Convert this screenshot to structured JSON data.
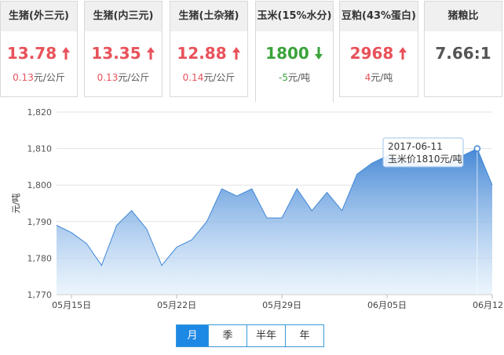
{
  "cards": [
    {
      "title": "生猪(外三元)",
      "value": "13.78",
      "change": "0.13",
      "unit": "元/公斤",
      "dir": "up"
    },
    {
      "title": "生猪(内三元)",
      "value": "13.35",
      "change": "0.13",
      "unit": "元/公斤",
      "dir": "up"
    },
    {
      "title": "生猪(土杂猪)",
      "value": "12.88",
      "change": "0.14",
      "unit": "元/公斤",
      "dir": "up"
    },
    {
      "title": "玉米(15%水分)",
      "value": "1800",
      "change": "-5",
      "unit": "元/吨",
      "dir": "down"
    },
    {
      "title": "豆粕(43%蛋白)",
      "value": "2968",
      "change": "4",
      "unit": "元/吨",
      "dir": "up"
    },
    {
      "title": "猪粮比",
      "value": "7.66:1",
      "change": "",
      "unit": "",
      "dir": "neutral"
    }
  ],
  "colors": {
    "up": "#e8525a",
    "down": "#3aa33a",
    "line": "#3f86d6",
    "accent": "#1e88e5"
  },
  "periods": [
    "月",
    "季",
    "半年",
    "年"
  ],
  "active_period": "月",
  "chart_data": {
    "type": "area",
    "ylabel": "元/吨",
    "ylim": [
      1770,
      1820
    ],
    "yticks": [
      "1,770",
      "1,780",
      "1,790",
      "1,800",
      "1,810",
      "1,820"
    ],
    "xtick_labels": [
      "05月15日",
      "05月22日",
      "05月29日",
      "06月05日",
      "06月12日"
    ],
    "x": [
      "2017-05-14",
      "2017-05-15",
      "2017-05-16",
      "2017-05-17",
      "2017-05-18",
      "2017-05-19",
      "2017-05-20",
      "2017-05-21",
      "2017-05-22",
      "2017-05-23",
      "2017-05-24",
      "2017-05-25",
      "2017-05-26",
      "2017-05-27",
      "2017-05-28",
      "2017-05-29",
      "2017-05-30",
      "2017-05-31",
      "2017-06-01",
      "2017-06-02",
      "2017-06-03",
      "2017-06-04",
      "2017-06-05",
      "2017-06-06",
      "2017-06-07",
      "2017-06-08",
      "2017-06-09",
      "2017-06-10",
      "2017-06-11",
      "2017-06-12"
    ],
    "values": [
      1789,
      1787,
      1784,
      1778,
      1789,
      1793,
      1788,
      1778,
      1783,
      1785,
      1790,
      1799,
      1797,
      1799,
      1791,
      1791,
      1799,
      1793,
      1798,
      1793,
      1803,
      1806,
      1808,
      1807,
      1806,
      1805,
      1806,
      1808,
      1810,
      1800
    ],
    "tooltip": {
      "date": "2017-06-11",
      "text": "玉米价1810元/吨"
    },
    "grid": true
  }
}
